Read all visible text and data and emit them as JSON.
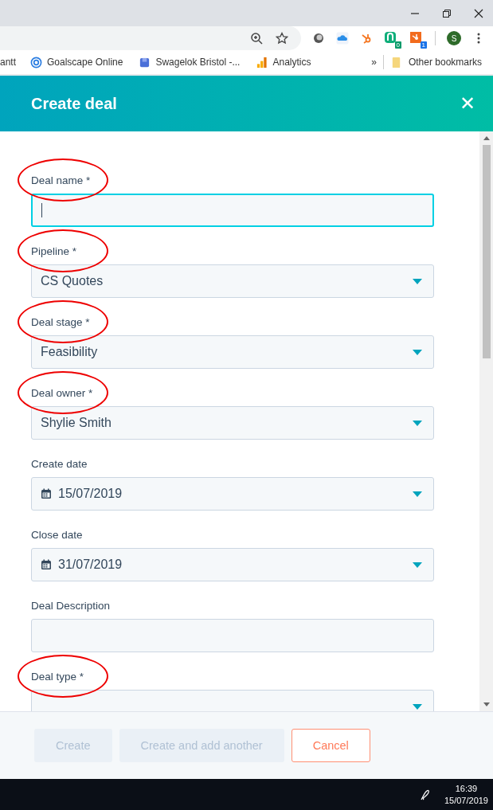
{
  "browser": {
    "profile_initial": "S",
    "extension_badges": [
      "0",
      "1"
    ],
    "bookmarks": [
      {
        "label": "antt"
      },
      {
        "label": "Goalscape Online"
      },
      {
        "label": "Swagelok Bristol -..."
      },
      {
        "label": "Analytics"
      }
    ],
    "overflow": "»",
    "other_bookmarks": "Other bookmarks"
  },
  "dialog": {
    "title": "Create deal",
    "close": "✕"
  },
  "fields": [
    {
      "label": "Deal name *",
      "kind": "text",
      "focused": true,
      "circled": true
    },
    {
      "label": "Pipeline *",
      "kind": "select",
      "value": "CS Quotes",
      "focused": false,
      "circled": true
    },
    {
      "label": "Deal stage *",
      "kind": "select",
      "value": "Feasibility",
      "focused": false,
      "circled": true
    },
    {
      "label": "Deal owner *",
      "kind": "select",
      "value": "Shylie Smith",
      "focused": false,
      "circled": true
    },
    {
      "label": "Create date",
      "kind": "date",
      "value": "15/07/2019",
      "focused": false,
      "circled": false
    },
    {
      "label": "Close date",
      "kind": "date",
      "value": "31/07/2019",
      "focused": false,
      "circled": false
    },
    {
      "label": "Deal Description",
      "kind": "text",
      "focused": false,
      "circled": false
    },
    {
      "label": "Deal type *",
      "kind": "select",
      "focused": false,
      "circled": true
    }
  ],
  "buttons": [
    {
      "label": "Create",
      "kind": "primary",
      "disabled": true
    },
    {
      "label": "Create and add another",
      "kind": "secondary",
      "disabled": true
    },
    {
      "label": "Cancel",
      "kind": "cancel",
      "disabled": false
    }
  ],
  "taskbar": {
    "time": "16:39",
    "date": "15/07/2019"
  }
}
